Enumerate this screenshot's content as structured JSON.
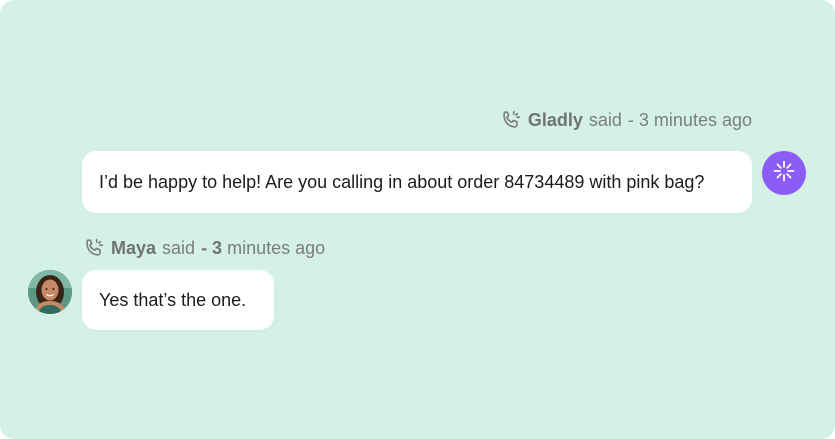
{
  "agent_message": {
    "sender": "Gladly",
    "said": "said",
    "time": "- 3 minutes ago",
    "text": "I’d be happy to help! Are you calling in about order 84734489 with pink bag?",
    "avatar_icon": "sparkle-icon",
    "channel_icon": "phone-call-icon",
    "avatar_color": "#8b5cf6"
  },
  "customer_message": {
    "sender": "Maya",
    "said": "said",
    "time_prefix": "- 3",
    "time_suffix": "minutes ago",
    "text": "Yes that’s the one.",
    "channel_icon": "phone-call-icon"
  },
  "colors": {
    "background": "#d5f0e5",
    "bubble": "#ffffff",
    "meta_text": "#7a7f7d"
  }
}
